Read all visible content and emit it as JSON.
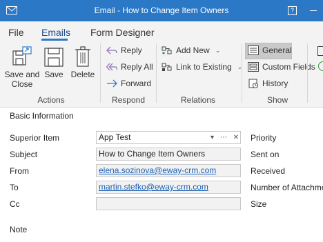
{
  "window": {
    "title": "Email - How to Change Item Owners",
    "help_label": "?"
  },
  "tabs": [
    {
      "label": "File"
    },
    {
      "label": "Emails"
    },
    {
      "label": "Form Designer"
    }
  ],
  "ribbon": {
    "actions": {
      "group_label": "Actions",
      "save_and_close": [
        "Save and",
        "Close"
      ],
      "save": "Save",
      "delete": "Delete"
    },
    "respond": {
      "group_label": "Respond",
      "reply": "Reply",
      "reply_all": "Reply All",
      "forward": "Forward"
    },
    "relations": {
      "group_label": "Relations",
      "add_new": "Add New",
      "link_to_existing": "Link to Existing"
    },
    "show": {
      "group_label": "Show",
      "general": "General",
      "custom_fields": "Custom Fields",
      "history": "History"
    }
  },
  "form": {
    "section_title": "Basic Information",
    "superior_item": {
      "label": "Superior Item",
      "value": "App Test"
    },
    "subject": {
      "label": "Subject",
      "value": "How to Change Item Owners"
    },
    "from": {
      "label": "From",
      "value": "elena.sozinova@eway-crm.com"
    },
    "to": {
      "label": "To",
      "value": "martin.stefko@eway-crm.com"
    },
    "cc": {
      "label": "Cc",
      "value": ""
    },
    "note": {
      "label": "Note"
    },
    "right_labels": {
      "priority": "Priority",
      "sent_on": "Sent on",
      "received": "Received",
      "number_of_attachments": "Number of Attachments",
      "size": "Size"
    }
  },
  "colors": {
    "titlebar": "#2b78c7",
    "ribbon": "#f3f3f3",
    "link": "#1a5fb4"
  }
}
